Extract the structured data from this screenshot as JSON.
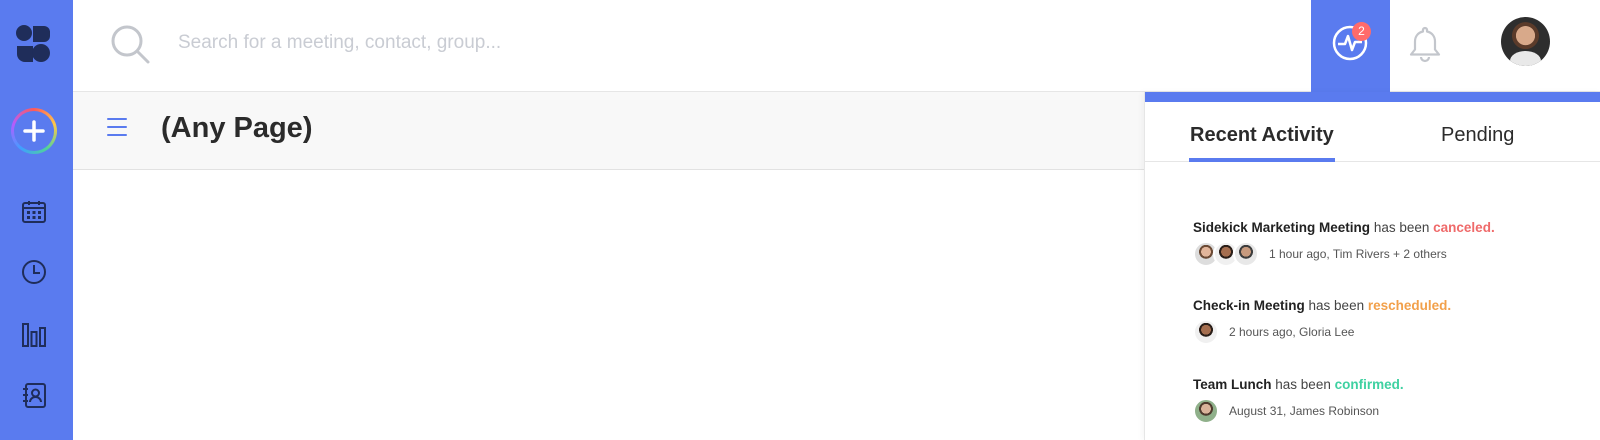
{
  "search": {
    "placeholder": "Search for a meeting, contact, group..."
  },
  "notifications": {
    "activity_count": "2"
  },
  "page": {
    "title": "(Any Page)"
  },
  "panel": {
    "tabs": [
      {
        "label": "Recent Activity",
        "active": true
      },
      {
        "label": "Pending",
        "active": false
      }
    ],
    "items": [
      {
        "title": "Sidekick Marketing Meeting",
        "verb": "has been",
        "status": "canceled.",
        "meta": "1 hour ago, Tim Rivers + 2 others"
      },
      {
        "title": "Check-in Meeting",
        "verb": "has been",
        "status": "rescheduled.",
        "meta": "2 hours ago, Gloria Lee"
      },
      {
        "title": "Team Lunch",
        "verb": "has been",
        "status": "confirmed.",
        "meta": "August 31, James Robinson"
      }
    ]
  },
  "colors": {
    "brand": "#5a7bef",
    "canceled": "#ef6a6a",
    "rescheduled": "#f2a04a",
    "confirmed": "#3ed1a1"
  },
  "icons": [
    "logo-icon",
    "add-icon",
    "calendar-icon",
    "clock-icon",
    "analytics-icon",
    "contacts-icon",
    "search-icon",
    "activity-icon",
    "bell-icon",
    "hamburger-icon"
  ]
}
